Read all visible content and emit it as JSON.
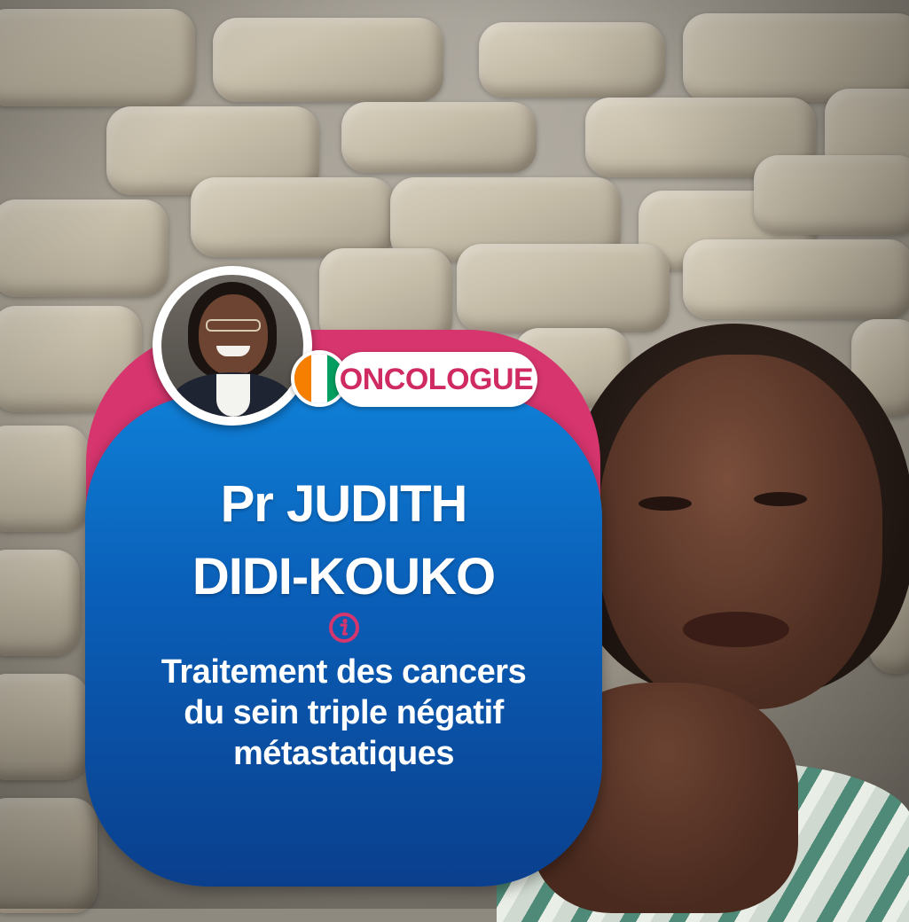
{
  "badge": {
    "label": "ONCOLOGUE"
  },
  "speaker": {
    "name_line1": "Pr JUDITH",
    "name_line2": "DIDI-KOUKO"
  },
  "topic": {
    "line1": "Traitement des cancers",
    "line2": "du sein triple négatif",
    "line3": "métastatiques"
  },
  "colors": {
    "accent_pink": "#d6356d",
    "card_blue_top": "#0f7fd6",
    "card_blue_bottom": "#0a3f8d",
    "flag_orange": "#f77f00",
    "flag_white": "#ffffff",
    "flag_green": "#009e60"
  },
  "icons": {
    "info": "info-circle-icon",
    "flag": "cote-divoire-flag-icon"
  }
}
